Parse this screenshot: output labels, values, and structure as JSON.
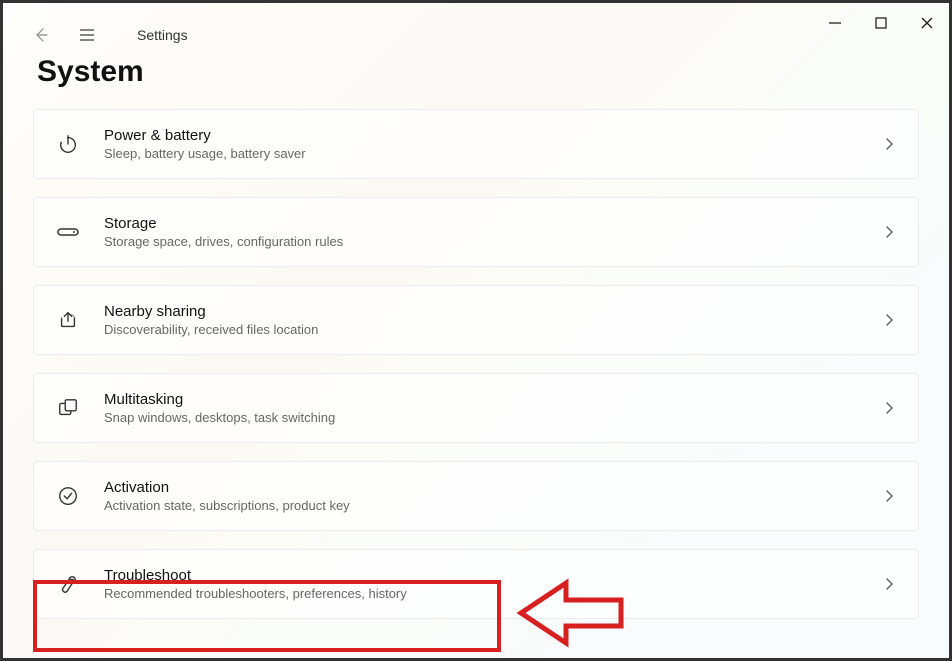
{
  "app": {
    "name": "Settings"
  },
  "page": {
    "heading": "System"
  },
  "items": [
    {
      "title": "Power & battery",
      "subtitle": "Sleep, battery usage, battery saver"
    },
    {
      "title": "Storage",
      "subtitle": "Storage space, drives, configuration rules"
    },
    {
      "title": "Nearby sharing",
      "subtitle": "Discoverability, received files location"
    },
    {
      "title": "Multitasking",
      "subtitle": "Snap windows, desktops, task switching"
    },
    {
      "title": "Activation",
      "subtitle": "Activation state, subscriptions, product key"
    },
    {
      "title": "Troubleshoot",
      "subtitle": "Recommended troubleshooters, preferences, history"
    }
  ],
  "annotations": {
    "highlight_target": "Troubleshoot"
  }
}
